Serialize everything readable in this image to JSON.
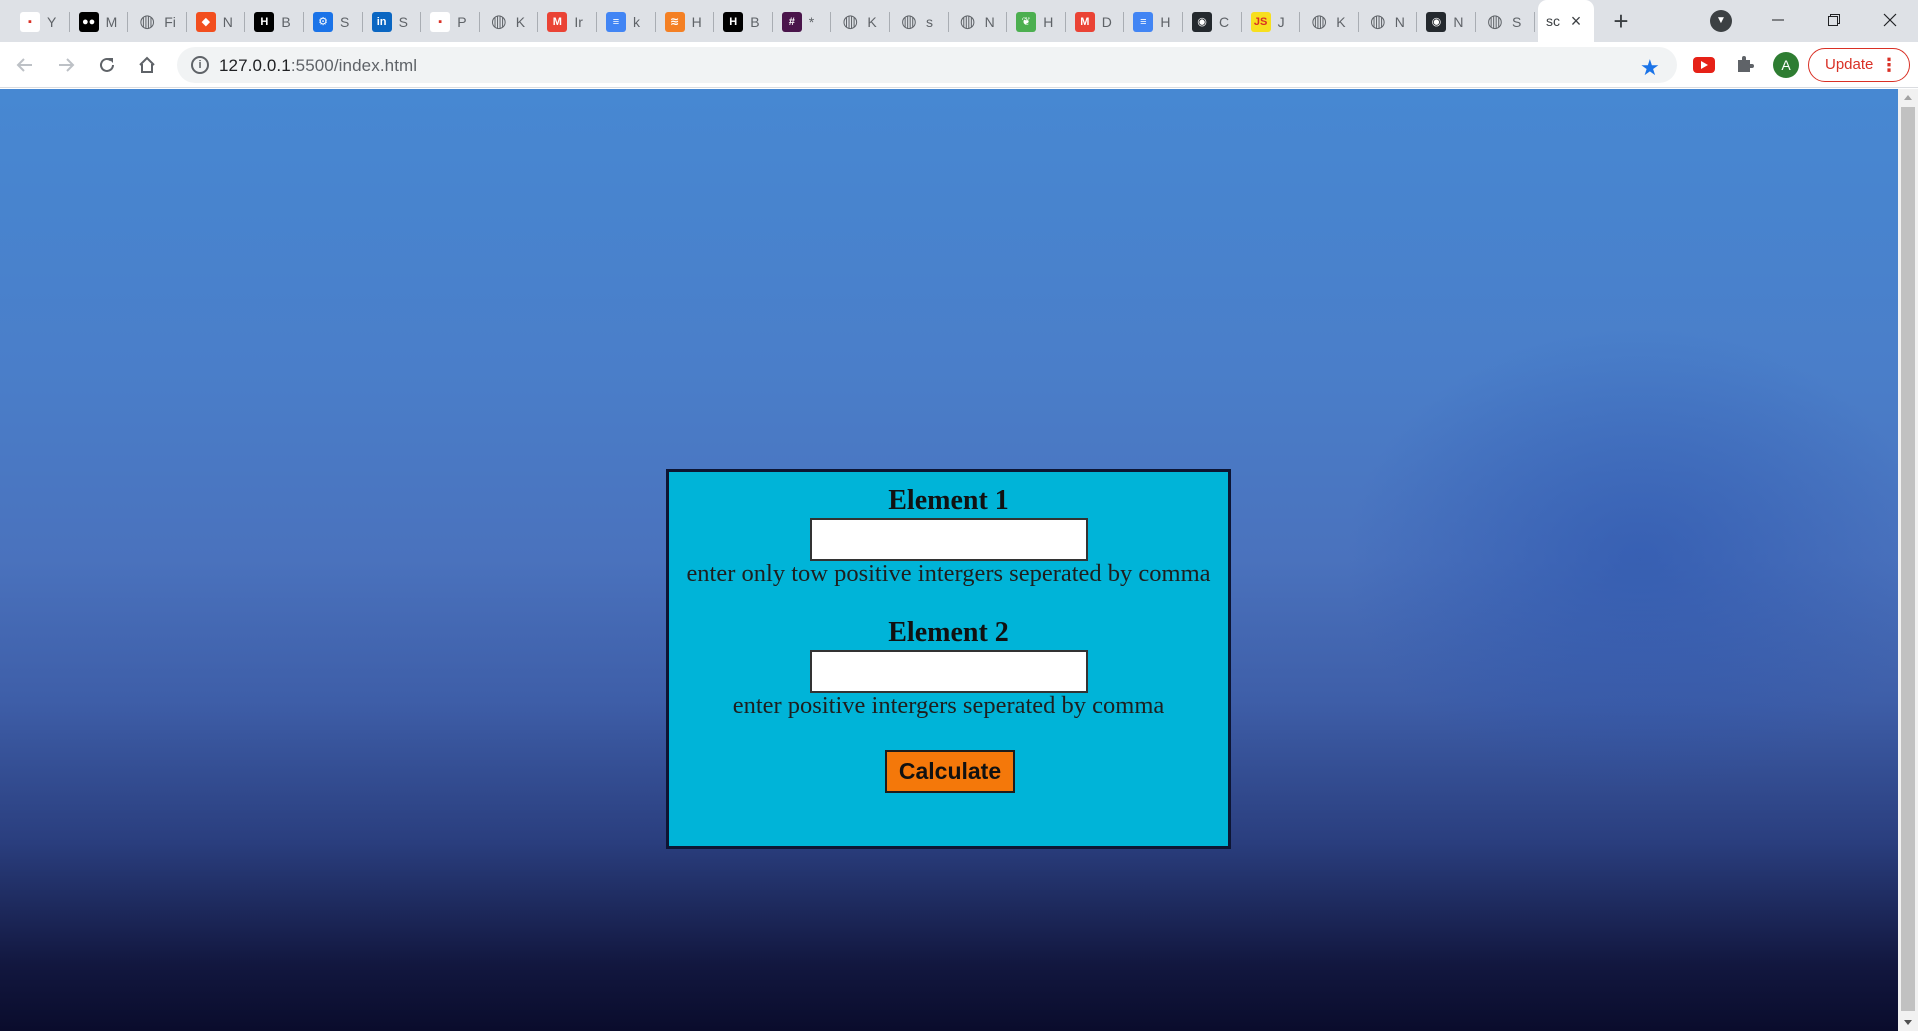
{
  "browser": {
    "tabs": [
      {
        "title": "Y",
        "icon": "youtube-icon",
        "color": "#ffffff"
      },
      {
        "title": "M",
        "icon": "medium-icon",
        "color": "#000000"
      },
      {
        "title": "Fi",
        "icon": "globe-icon",
        "color": "#5f6368"
      },
      {
        "title": "N",
        "icon": "figma-icon",
        "color": "#f24e1e"
      },
      {
        "title": "B",
        "icon": "hn-icon",
        "color": "#000000"
      },
      {
        "title": "S",
        "icon": "gear-icon",
        "color": "#1a73e8"
      },
      {
        "title": "S",
        "icon": "linkedin-icon",
        "color": "#0a66c2"
      },
      {
        "title": "P",
        "icon": "pin-icon",
        "color": "#ffffff"
      },
      {
        "title": "K",
        "icon": "globe-icon",
        "color": "#5f6368"
      },
      {
        "title": "Ir",
        "icon": "gmail-icon",
        "color": "#ea4335"
      },
      {
        "title": "k",
        "icon": "docs-icon",
        "color": "#4285f4"
      },
      {
        "title": "H",
        "icon": "stackoverflow-icon",
        "color": "#f48024"
      },
      {
        "title": "B",
        "icon": "hn-icon",
        "color": "#000000"
      },
      {
        "title": "*",
        "icon": "slack-icon",
        "color": "#4a154b"
      },
      {
        "title": "K",
        "icon": "globe-icon",
        "color": "#5f6368"
      },
      {
        "title": "s",
        "icon": "globe-icon",
        "color": "#5f6368"
      },
      {
        "title": "N",
        "icon": "globe-icon",
        "color": "#5f6368"
      },
      {
        "title": "H",
        "icon": "leaf-icon",
        "color": "#4caf50"
      },
      {
        "title": "D",
        "icon": "gmail-icon",
        "color": "#ea4335"
      },
      {
        "title": "H",
        "icon": "docs-icon",
        "color": "#4285f4"
      },
      {
        "title": "C",
        "icon": "github-icon",
        "color": "#24292e"
      },
      {
        "title": "J",
        "icon": "js-icon",
        "color": "#f7df1e"
      },
      {
        "title": "K",
        "icon": "globe-icon",
        "color": "#5f6368"
      },
      {
        "title": "N",
        "icon": "globe-icon",
        "color": "#5f6368"
      },
      {
        "title": "N",
        "icon": "github-icon",
        "color": "#24292e"
      },
      {
        "title": "S",
        "icon": "globe-icon",
        "color": "#5f6368"
      }
    ],
    "active_tab": {
      "title": "sc"
    },
    "url": {
      "host": "127.0.0.1",
      "rest": ":5500/index.html"
    },
    "avatar_letter": "A",
    "update_label": "Update"
  },
  "form": {
    "element1_label": "Element 1",
    "element1_value": "",
    "element1_hint": "enter only tow positive intergers seperated by comma",
    "element2_label": "Element 2",
    "element2_value": "",
    "element2_hint": "enter positive intergers seperated by comma",
    "calculate_label": "Calculate"
  },
  "colors": {
    "card_bg": "#00b4d8",
    "button_bg": "#f4780a",
    "page_top": "#4788d2",
    "page_bottom": "#0a0c2c"
  }
}
